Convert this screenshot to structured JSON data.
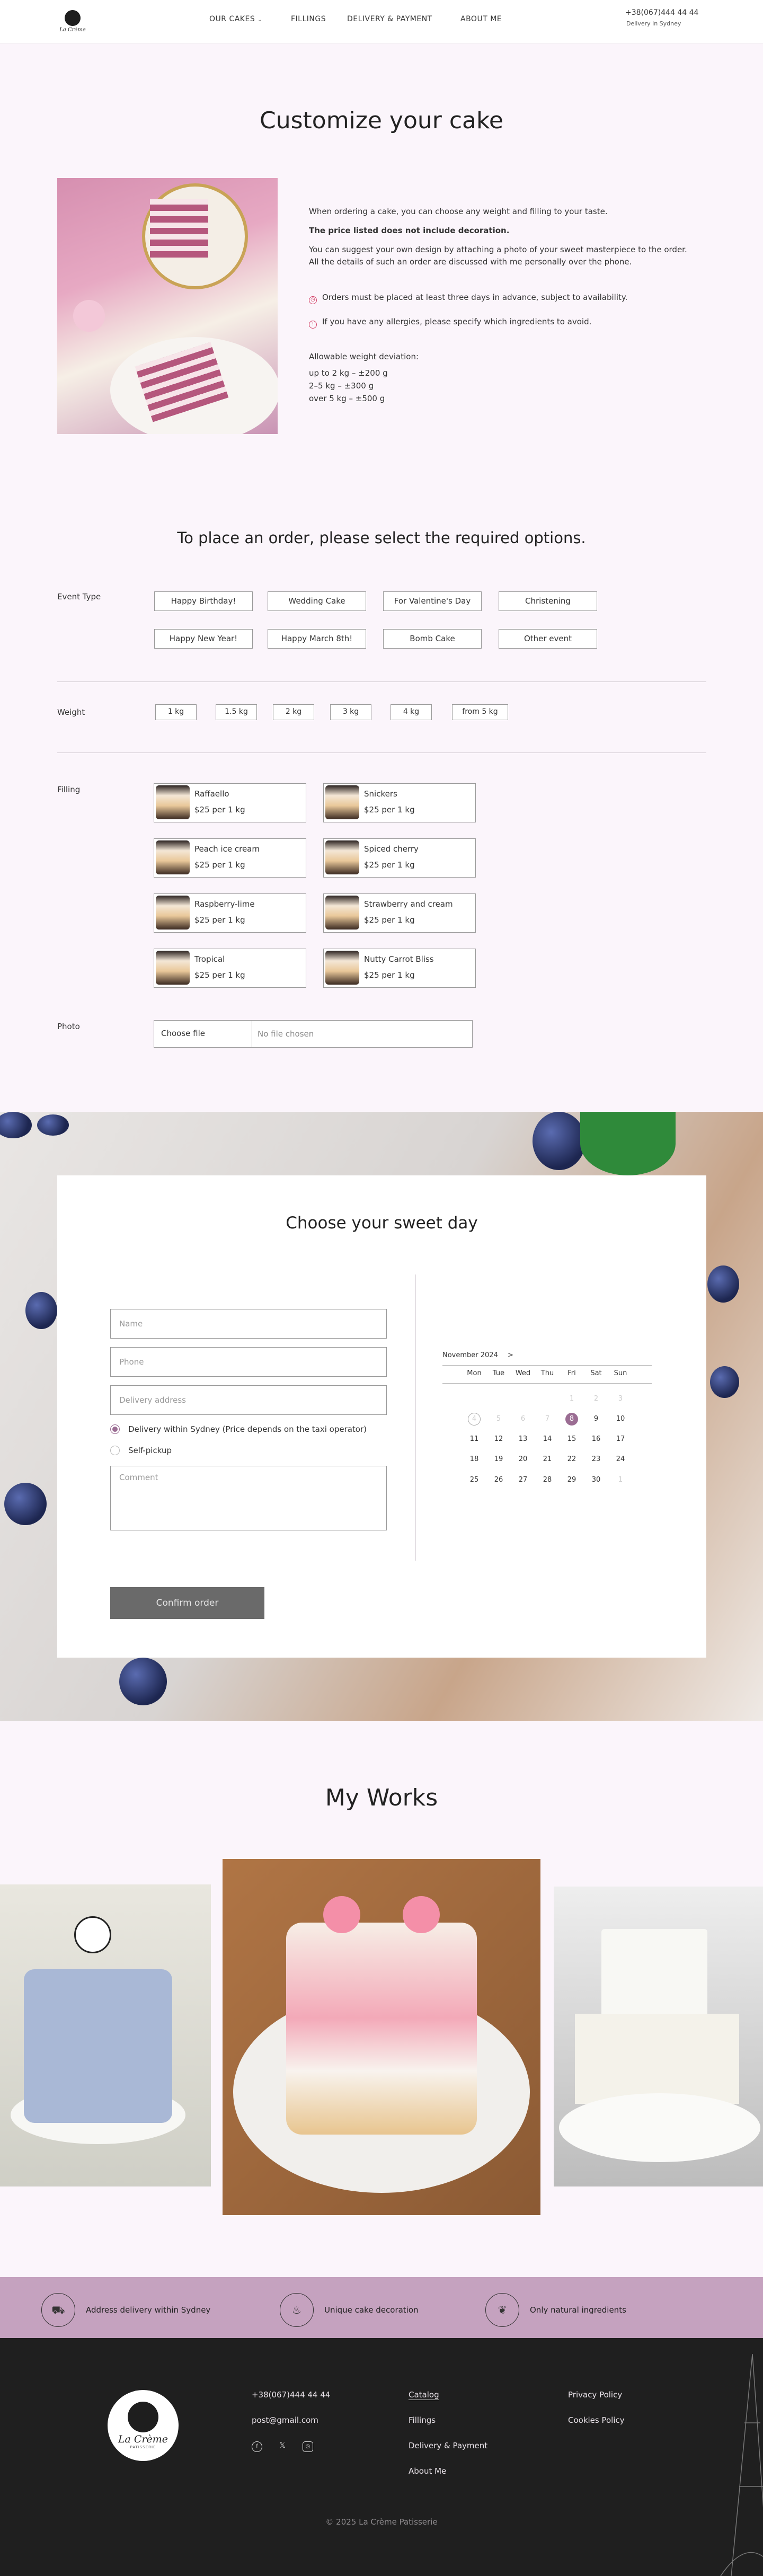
{
  "header": {
    "logo_text": "La Crème",
    "nav": [
      {
        "label": "OUR CAKES"
      },
      {
        "label": "FILLINGS"
      },
      {
        "label": "DELIVERY & PAYMENT"
      },
      {
        "label": "ABOUT ME"
      }
    ],
    "phone": "+38(067)444 44 44",
    "location": "Delivery in Sydney"
  },
  "customize": {
    "title": "Customize your cake",
    "p1": "When ordering a cake, you can choose any weight and filling to your taste.",
    "p2": "The price listed does not include decoration.",
    "p3": "You can suggest your own design by attaching a photo of your sweet masterpiece to the order. All the details of such an order are discussed with me personally over the phone.",
    "warn1": "Orders must be placed at least three days in advance, subject to availability.",
    "warn2": "If you have any allergies, please specify which ingredients to avoid.",
    "deviation_title": "Allowable weight deviation:",
    "deviation": [
      "up to 2 kg – ±200 g",
      "2–5 kg – ±300 g",
      "over 5 kg – ±500 g"
    ]
  },
  "order": {
    "title": "To place an order, please select the required options.",
    "event_label": "Event Type",
    "events": [
      "Happy Birthday!",
      "Wedding Cake",
      "For Valentine's Day",
      "Christening",
      "Happy New Year!",
      "Happy March 8th!",
      "Bomb Cake",
      "Other event"
    ],
    "weight_label": "Weight",
    "weights": [
      "1 kg",
      "1.5 kg",
      "2 kg",
      "3 kg",
      "4 kg",
      "from 5 kg"
    ],
    "filling_label": "Filling",
    "fillings": [
      {
        "name": "Raffaello",
        "price": "$25 per 1 kg"
      },
      {
        "name": "Snickers",
        "price": "$25 per 1 kg"
      },
      {
        "name": "Peach ice cream",
        "price": "$25 per 1 kg"
      },
      {
        "name": "Spiced cherry",
        "price": "$25 per 1 kg"
      },
      {
        "name": "Raspberry-lime",
        "price": "$25 per 1 kg"
      },
      {
        "name": "Strawberry and cream",
        "price": "$25 per 1 kg"
      },
      {
        "name": "Tropical",
        "price": "$25 per 1 kg"
      },
      {
        "name": "Nutty Carrot Bliss",
        "price": "$25 per 1 kg"
      }
    ],
    "photo_label": "Photo",
    "file_button": "Choose file",
    "file_status": "No file chosen"
  },
  "sweet_day": {
    "title": "Choose your sweet day",
    "name_placeholder": "Name",
    "phone_placeholder": "Phone",
    "address_placeholder": "Delivery address",
    "delivery_option": "Delivery within Sydney (Price depends on the taxi operator)",
    "pickup_option": "Self-pickup",
    "comment_placeholder": "Comment",
    "confirm": "Confirm order",
    "calendar": {
      "month": "November 2024",
      "next": ">",
      "dow": [
        "Mon",
        "Tue",
        "Wed",
        "Thu",
        "Fri",
        "Sat",
        "Sun"
      ],
      "rows": [
        [
          "",
          "",
          "",
          "",
          "1",
          "2",
          "3"
        ],
        [
          "4",
          "5",
          "6",
          "7",
          "8",
          "9",
          "10"
        ],
        [
          "11",
          "12",
          "13",
          "14",
          "15",
          "16",
          "17"
        ],
        [
          "18",
          "19",
          "20",
          "21",
          "22",
          "23",
          "24"
        ],
        [
          "25",
          "26",
          "27",
          "28",
          "29",
          "30",
          "1"
        ]
      ]
    }
  },
  "works": {
    "title": "My Works"
  },
  "features": [
    {
      "icon": "truck-icon",
      "glyph": "⛟",
      "text": "Address delivery within Sydney"
    },
    {
      "icon": "cake-icon",
      "glyph": "♨",
      "text": "Unique cake decoration"
    },
    {
      "icon": "leaf-icon",
      "glyph": "❦",
      "text": "Only natural ingredients"
    }
  ],
  "footer": {
    "logo_title": "La Crème",
    "logo_sub": "PATISSERIE",
    "phone": "+38(067)444 44 44",
    "email": "post@gmail.com",
    "links": [
      "Catalog",
      "Fillings",
      "Delivery & Payment",
      "About Me"
    ],
    "legal": [
      "Privacy Policy",
      "Cookies Policy"
    ],
    "copyright": "© 2025 La Crème Patisserie"
  },
  "colors": {
    "accent": "#c5a2bf",
    "radio": "#9b6d93",
    "warn": "#d23c63",
    "footer": "#1f1f1f"
  }
}
